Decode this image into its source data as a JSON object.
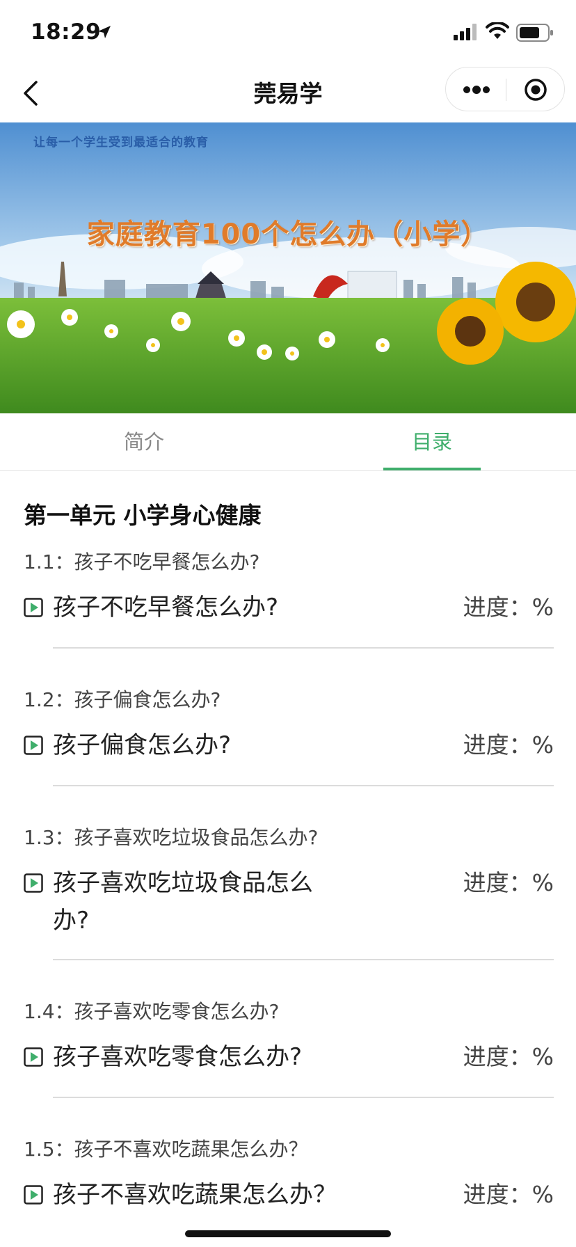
{
  "status": {
    "time": "18:29"
  },
  "nav": {
    "title": "莞易学"
  },
  "banner": {
    "slogan": "让每一个学生受到最适合的教育",
    "title": "家庭教育100个怎么办（小学）"
  },
  "tabs": [
    {
      "label": "简介",
      "active": false
    },
    {
      "label": "目录",
      "active": true
    }
  ],
  "colors": {
    "accent": "#3fae6b",
    "banner_title": "#e07b2a"
  },
  "unit": {
    "title": "第一单元 小学身心健康"
  },
  "items": [
    {
      "subtitle": "1.1：孩子不吃早餐怎么办?",
      "lesson": "孩子不吃早餐怎么办?",
      "progress": "进度：%"
    },
    {
      "subtitle": "1.2：孩子偏食怎么办?",
      "lesson": "孩子偏食怎么办?",
      "progress": "进度：%"
    },
    {
      "subtitle": "1.3：孩子喜欢吃垃圾食品怎么办?",
      "lesson": "孩子喜欢吃垃圾食品怎么办?",
      "progress": "进度：%"
    },
    {
      "subtitle": "1.4：孩子喜欢吃零食怎么办?",
      "lesson": "孩子喜欢吃零食怎么办?",
      "progress": "进度：%"
    },
    {
      "subtitle": "1.5：孩子不喜欢吃蔬果怎么办？",
      "lesson": "孩子不喜欢吃蔬果怎么办？",
      "progress": "进度：%"
    }
  ]
}
